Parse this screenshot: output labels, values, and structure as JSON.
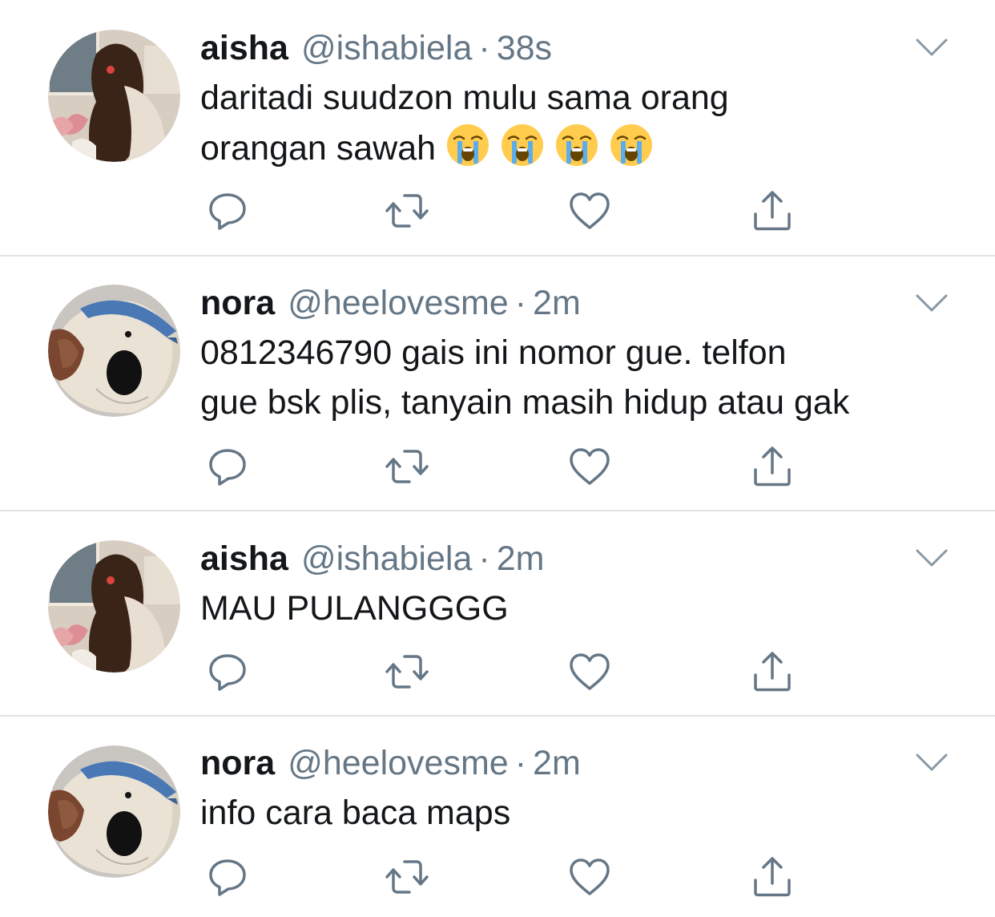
{
  "icons": {
    "more": "chevron-down-icon",
    "reply": "reply-icon",
    "retweet": "retweet-icon",
    "like": "heart-icon",
    "share": "share-icon",
    "emoji": "loudly-crying-face-emoji"
  },
  "colors": {
    "icon_gray": "#657786",
    "text": "#14171a",
    "divider": "#e1e4e7"
  },
  "tweets": [
    {
      "name": "aisha",
      "handle": "@ishabiela",
      "separator": "·",
      "time": "38s",
      "text_line1": "daritadi suudzon mulu sama orang",
      "text_line2": "orangan sawah",
      "emoji_count": 4
    },
    {
      "name": "nora",
      "handle": "@heelovesme",
      "separator": "·",
      "time": "2m",
      "text_line1": "0812346790 gais ini nomor gue. telfon",
      "text_line2": "gue bsk plis, tanyain masih hidup atau gak"
    },
    {
      "name": "aisha",
      "handle": "@ishabiela",
      "separator": "·",
      "time": "2m",
      "text_line1": "MAU PULANGGGG"
    },
    {
      "name": "nora",
      "handle": "@heelovesme",
      "separator": "·",
      "time": "2m",
      "text_line1": "info cara baca maps"
    }
  ]
}
